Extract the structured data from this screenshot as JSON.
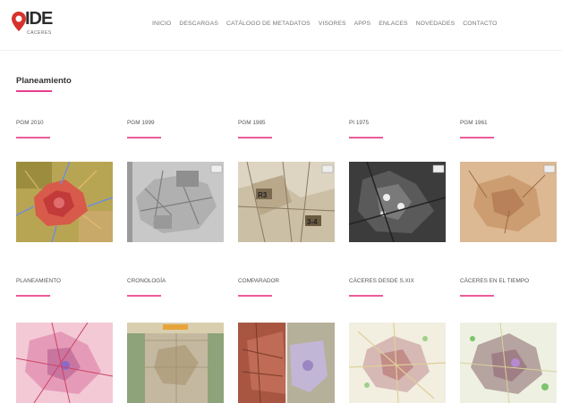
{
  "header": {
    "logo_text": "IDE",
    "logo_sub": "CÁCERES",
    "nav": [
      "INICIO",
      "DESCARGAS",
      "CATÁLOGO DE METADATOS",
      "VISORES",
      "APPS",
      "ENLACES",
      "NOVEDADES",
      "CONTACTO"
    ]
  },
  "section": {
    "title": "Planeamiento"
  },
  "row1": [
    {
      "label": "PGM 2010",
      "icon": "map-pgm2010"
    },
    {
      "label": "PGM 1999",
      "icon": "map-pgm1999"
    },
    {
      "label": "PGM 1985",
      "icon": "map-pgm1985"
    },
    {
      "label": "PI 1975",
      "icon": "map-pi1975"
    },
    {
      "label": "PGM 1961",
      "icon": "map-pgm1961"
    }
  ],
  "row2": [
    {
      "label": "PLANEAMIENTO",
      "icon": "map-planeamiento"
    },
    {
      "label": "CRONOLOGÍA",
      "icon": "map-cronologia"
    },
    {
      "label": "COMPARADOR",
      "icon": "map-comparador"
    },
    {
      "label": "CÁCERES DESDE S.XIX",
      "icon": "map-caceres-sxix"
    },
    {
      "label": "CÁCERES EN EL TIEMPO",
      "icon": "map-caceres-tiempo"
    }
  ],
  "colors": {
    "accent": "#ec5b9a",
    "logo_red": "#d6322d"
  }
}
